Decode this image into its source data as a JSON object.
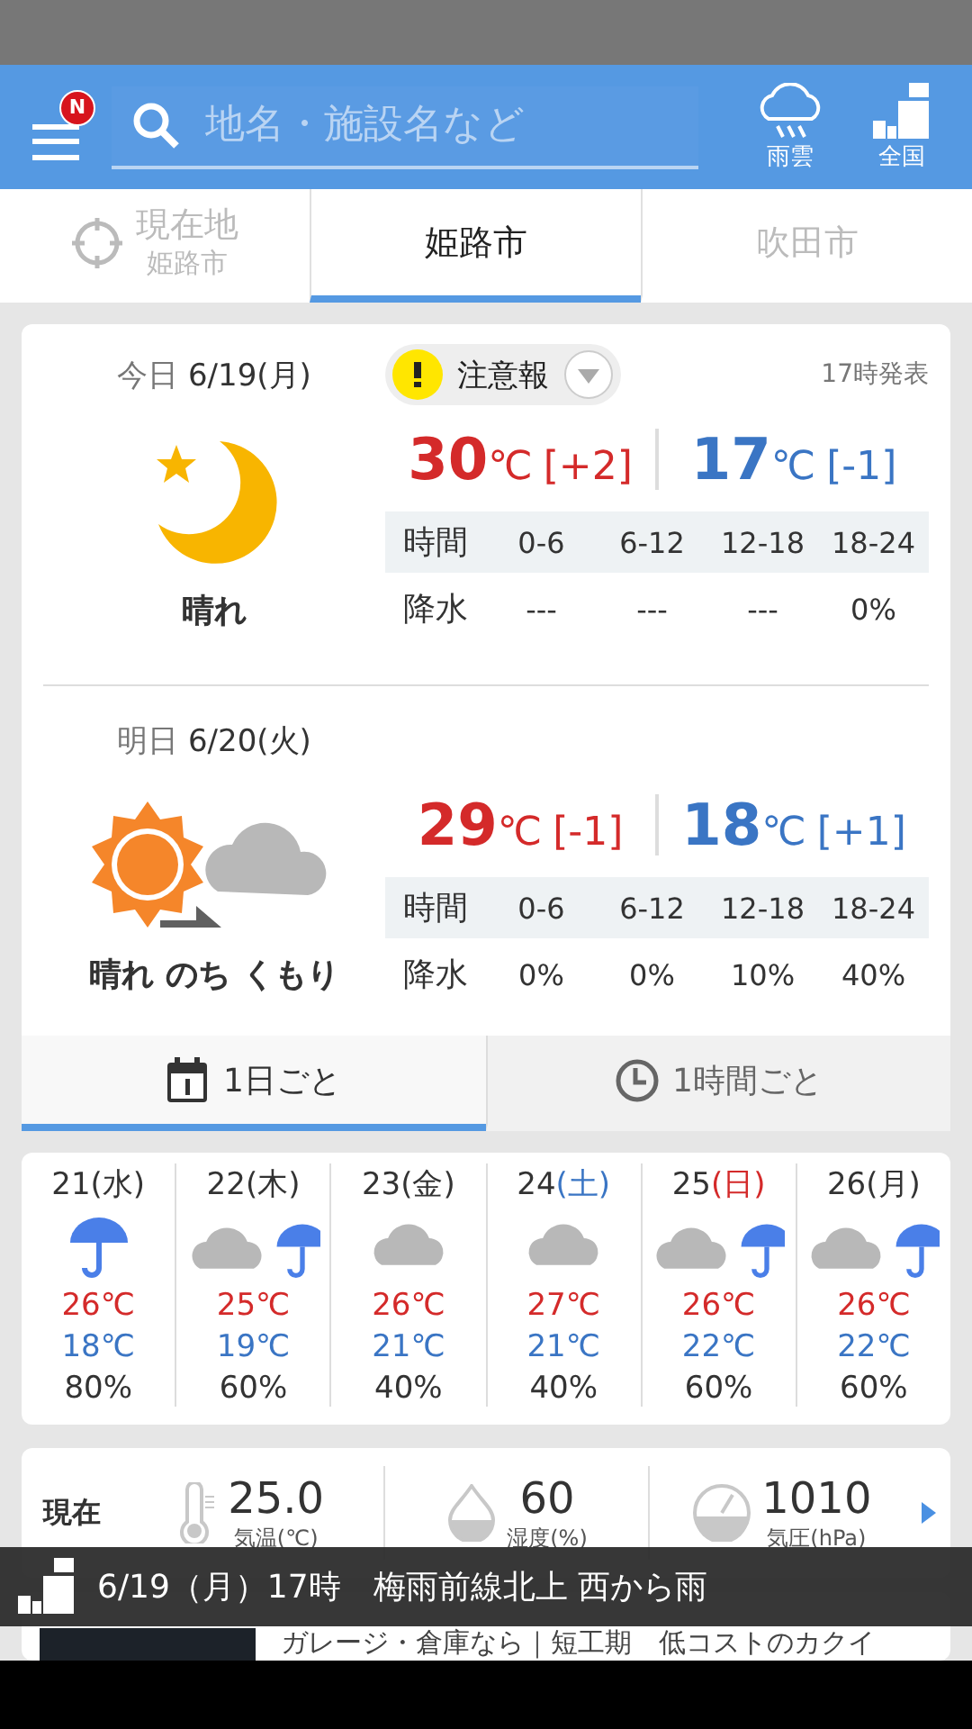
{
  "header": {
    "badge": "N",
    "search": {
      "placeholder": "地名・施設名など"
    },
    "actions": [
      {
        "kind": "rain_cloud",
        "label": "雨雲"
      },
      {
        "kind": "national",
        "label": "全国"
      }
    ]
  },
  "tabs": [
    {
      "kind": "location",
      "label": "現在地",
      "sublabel": "姫路市",
      "selected": false
    },
    {
      "kind": "city",
      "label": "姫路市",
      "selected": true
    },
    {
      "kind": "city",
      "label": "吹田市",
      "selected": false
    }
  ],
  "forecast": {
    "days": [
      {
        "label": "今日",
        "date": "6/19(月)",
        "warning": {
          "label": "注意報"
        },
        "issued": "17時発表",
        "kind": "moon",
        "weather": "晴れ",
        "high": {
          "value": "30",
          "unit": "℃",
          "diff": "[+2]"
        },
        "low": {
          "value": "17",
          "unit": "℃",
          "diff": "[-1]"
        },
        "time_label": "時間",
        "slots": [
          "0-6",
          "6-12",
          "12-18",
          "18-24"
        ],
        "precip_label": "降水",
        "precip": [
          "---",
          "---",
          "---",
          "0%"
        ]
      },
      {
        "label": "明日",
        "date": "6/20(火)",
        "kind": "sunny_then_cloudy",
        "weather": "晴れ のち くもり",
        "high": {
          "value": "29",
          "unit": "℃",
          "diff": "[-1]"
        },
        "low": {
          "value": "18",
          "unit": "℃",
          "diff": "[+1]"
        },
        "time_label": "時間",
        "slots": [
          "0-6",
          "6-12",
          "12-18",
          "18-24"
        ],
        "precip_label": "降水",
        "precip": [
          "0%",
          "0%",
          "10%",
          "40%"
        ]
      }
    ],
    "view_tabs": [
      {
        "kind": "calendar",
        "label": "1日ごと",
        "selected": true
      },
      {
        "kind": "clock",
        "label": "1時間ごと",
        "selected": false
      }
    ]
  },
  "weekly": [
    {
      "day": "21",
      "weekday": "(水)",
      "color": "#333333",
      "kind": "rain",
      "high": "26℃",
      "low": "18℃",
      "precip": "80%"
    },
    {
      "day": "22",
      "weekday": "(木)",
      "color": "#333333",
      "kind": "cloudy_rain",
      "high": "25℃",
      "low": "19℃",
      "precip": "60%"
    },
    {
      "day": "23",
      "weekday": "(金)",
      "color": "#333333",
      "kind": "cloudy",
      "high": "26℃",
      "low": "21℃",
      "precip": "40%"
    },
    {
      "day": "24",
      "weekday": "(土)",
      "color": "#3a75c4",
      "kind": "cloudy",
      "high": "27℃",
      "low": "21℃",
      "precip": "40%"
    },
    {
      "day": "25",
      "weekday": "(日)",
      "color": "#d42a2a",
      "kind": "cloudy_rain",
      "high": "26℃",
      "low": "22℃",
      "precip": "60%"
    },
    {
      "day": "26",
      "weekday": "(月)",
      "color": "#333333",
      "kind": "cloudy_rain",
      "high": "26℃",
      "low": "22℃",
      "precip": "60%"
    }
  ],
  "current": {
    "label": "現在",
    "items": [
      {
        "kind": "thermometer",
        "value": "25.0",
        "label": "気温(℃)"
      },
      {
        "kind": "humidity",
        "value": "60",
        "label": "湿度(%)"
      },
      {
        "kind": "pressure",
        "value": "1010",
        "label": "気圧(hPa)"
      }
    ]
  },
  "banner": {
    "text": "6/19（月）17時　梅雨前線北上 西から雨"
  },
  "ad": {
    "text": "ガレージ・倉庫なら｜短工期　低コストのカクイ"
  }
}
